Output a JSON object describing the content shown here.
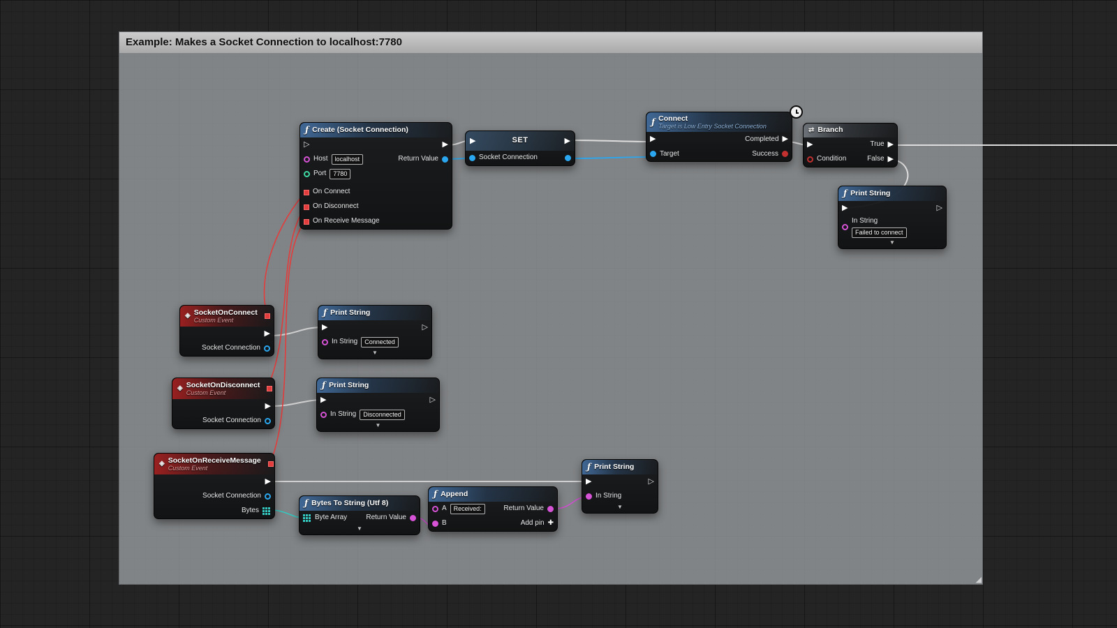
{
  "comment": {
    "title": "Example: Makes a Socket Connection to localhost:7780"
  },
  "icons": {
    "fn": "ƒ",
    "event": "◈",
    "branch": "⇄",
    "exec_filled": "▶",
    "exec_hollow": "▷",
    "collapse": "▼",
    "add": "✚",
    "resize": "◢"
  },
  "colors": {
    "exec_wire": "#dedede",
    "object_pin": "#2ba7f0",
    "string_pin": "#d653d6",
    "int_pin": "#3fd9a4",
    "bool_pin": "#c23030",
    "delegate_pin": "#e23c3c",
    "bytes_pin": "#35c8c0",
    "function_header": "#426c9c",
    "event_header": "#a02020",
    "comment_bg": "#999c9f"
  },
  "nodes": {
    "create": {
      "title": "Create (Socket Connection)",
      "host": "Host",
      "host_value": "localhost",
      "return_value": "Return Value",
      "port": "Port",
      "port_value": "7780",
      "on_connect": "On Connect",
      "on_disconnect": "On Disconnect",
      "on_receive_message": "On Receive Message"
    },
    "set": {
      "title": "SET",
      "socket_connection": "Socket Connection"
    },
    "connect": {
      "title": "Connect",
      "subtitle": "Target is Low Entry Socket Connection",
      "completed": "Completed",
      "target": "Target",
      "success": "Success"
    },
    "branch": {
      "title": "Branch",
      "condition": "Condition",
      "true_label": "True",
      "false_label": "False"
    },
    "print_failed": {
      "title": "Print String",
      "in_string": "In String",
      "value": "Failed to connect"
    },
    "event_connect": {
      "title": "SocketOnConnect",
      "subtitle": "Custom Event",
      "socket_connection": "Socket Connection"
    },
    "print_connected": {
      "title": "Print String",
      "in_string": "In String",
      "value": "Connected"
    },
    "event_disconnect": {
      "title": "SocketOnDisconnect",
      "subtitle": "Custom Event",
      "socket_connection": "Socket Connection"
    },
    "print_disconnected": {
      "title": "Print String",
      "in_string": "In String",
      "value": "Disconnected"
    },
    "event_receive": {
      "title": "SocketOnReceiveMessage",
      "subtitle": "Custom Event",
      "socket_connection": "Socket Connection",
      "bytes": "Bytes"
    },
    "bytes_to_string": {
      "title": "Bytes To String (Utf 8)",
      "byte_array": "Byte Array",
      "return_value": "Return Value"
    },
    "append": {
      "title": "Append",
      "a": "A",
      "a_value": "Received:",
      "b": "B",
      "return_value": "Return Value",
      "add_pin": "Add pin"
    },
    "print_received": {
      "title": "Print String",
      "in_string": "In String"
    }
  }
}
